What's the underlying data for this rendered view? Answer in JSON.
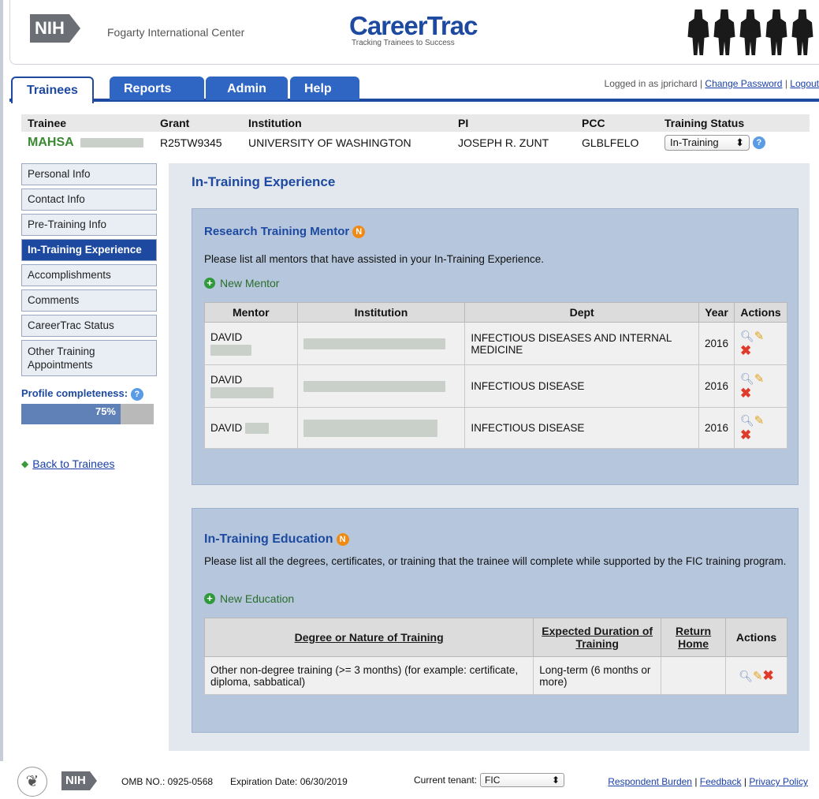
{
  "header": {
    "nih_logo": "NIH",
    "center_name": "Fogarty International Center",
    "app_title": "CareerTrac",
    "app_subtitle": "Tracking Trainees to Success"
  },
  "tabs": [
    {
      "label": "Trainees",
      "active": true
    },
    {
      "label": "Reports",
      "active": false
    },
    {
      "label": "Admin",
      "active": false
    },
    {
      "label": "Help",
      "active": false
    }
  ],
  "login": {
    "text": "Logged in as jprichard",
    "change_password": "Change Password",
    "logout": "Logout",
    "sep": "|"
  },
  "trainee_summary": {
    "headers": {
      "trainee": "Trainee",
      "grant": "Grant",
      "institution": "Institution",
      "pi": "PI",
      "pcc": "PCC",
      "status": "Training Status"
    },
    "values": {
      "trainee": "MAHSA",
      "grant": "R25TW9345",
      "institution": "UNIVERSITY OF WASHINGTON",
      "pi": "JOSEPH R. ZUNT",
      "pcc": "GLBLFELO",
      "status": "In-Training"
    }
  },
  "sidenav": {
    "items": [
      {
        "label": "Personal Info"
      },
      {
        "label": "Contact Info"
      },
      {
        "label": "Pre-Training Info"
      },
      {
        "label": "In-Training Experience"
      },
      {
        "label": "Accomplishments"
      },
      {
        "label": "Comments"
      },
      {
        "label": "CareerTrac Status"
      },
      {
        "label": "Other Training Appointments"
      }
    ],
    "profile_label": "Profile completeness:",
    "profile_percent_text": "75%",
    "profile_fraction": 0.75,
    "back_link": "Back to Trainees"
  },
  "main": {
    "title": "In-Training Experience",
    "mentor_section": {
      "title": "Research Training Mentor",
      "badge": "N",
      "description": "Please list all mentors that have assisted in your In-Training Experience.",
      "new_link": "New Mentor",
      "columns": [
        "Mentor",
        "Institution",
        "Dept",
        "Year",
        "Actions"
      ],
      "rows": [
        {
          "mentor": "DAVID",
          "dept": "INFECTIOUS DISEASES AND INTERNAL MEDICINE",
          "year": "2016"
        },
        {
          "mentor": "DAVID",
          "dept": "INFECTIOUS DISEASE",
          "year": "2016"
        },
        {
          "mentor": "DAVID",
          "dept": "INFECTIOUS DISEASE",
          "year": "2016"
        }
      ]
    },
    "education_section": {
      "title": "In-Training Education",
      "badge": "N",
      "description": "Please list all the degrees, certificates, or training that the trainee will complete while supported by the FIC training program.",
      "new_link": "New Education",
      "columns": [
        "Degree or Nature of Training",
        "Expected Duration of Training",
        "Return Home",
        "Actions"
      ],
      "rows": [
        {
          "degree": "Other non-degree training (>= 3 months) (for example: certificate, diploma, sabbatical)",
          "duration": "Long-term (6 months or more)",
          "return_home": ""
        }
      ]
    }
  },
  "footer": {
    "nih_logo": "NIH",
    "omb": "OMB NO.: 0925-0568",
    "expiration": "Expiration Date: 06/30/2019",
    "tenant_label": "Current tenant:",
    "tenant_value": "FIC",
    "links": [
      "Respondent Burden",
      "Feedback",
      "Privacy Policy"
    ],
    "sep": "|"
  },
  "colors": {
    "brand_blue": "#1d4aa0",
    "tab_blue": "#2f66c4",
    "trainee_green": "#3a8a32",
    "badge_orange": "#f08a14",
    "delete_red": "#e03b2a"
  }
}
